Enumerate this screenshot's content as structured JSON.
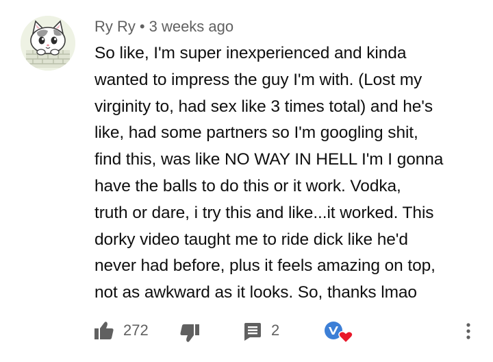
{
  "comment": {
    "author": "Ry Ry",
    "separator": "•",
    "timestamp": "3 weeks ago",
    "body_lines": [
      "So like, I'm super inexperienced and kinda",
      "wanted to impress the guy I'm with. (Lost my",
      "virginity to, had sex like 3 times total) and he's",
      "like, had some partners so I'm googling shit,",
      "find this, was like NO WAY IN HELL I'm I gonna",
      "have the balls to do this or it work. Vodka,",
      "truth or dare, i try this and like...it worked. This",
      "dorky video taught me to ride dick like he'd",
      "never had before, plus it feels amazing on top,",
      "not as awkward as it looks. So, thanks lmao"
    ]
  },
  "actions": {
    "like_icon": "thumbs-up-icon",
    "like_count": "272",
    "dislike_icon": "thumbs-down-icon",
    "reply_icon": "comment-icon",
    "reply_count": "2",
    "creator_heart_icon": "creator-heart-icon",
    "more_icon": "more-vertical-icon"
  },
  "colors": {
    "text_primary": "#0f0f0f",
    "text_secondary": "#606060",
    "icon": "#606060",
    "creator_badge": "#3d7fd6",
    "heart": "#e8182a"
  }
}
